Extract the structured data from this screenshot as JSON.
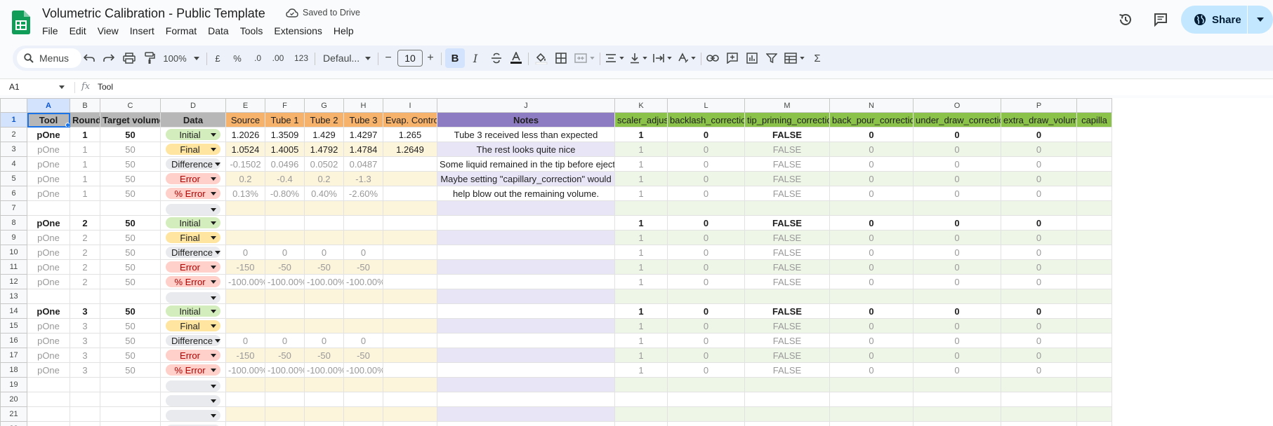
{
  "app": {
    "title": "Volumetric Calibration - Public Template",
    "saved_status": "Saved to Drive",
    "share_label": "Share"
  },
  "menubar": [
    "File",
    "Edit",
    "View",
    "Insert",
    "Format",
    "Data",
    "Tools",
    "Extensions",
    "Help"
  ],
  "toolbar": {
    "menus_label": "Menus",
    "zoom": "100%",
    "currency": "£",
    "percent": "%",
    "dec_decrease": ".0",
    "dec_increase": ".00",
    "number_format": "123",
    "font": "Defaul...",
    "font_size": "10",
    "minus": "−",
    "plus": "+",
    "bold": "B",
    "italic": "I",
    "sum": "Σ"
  },
  "formula_bar": {
    "cell_ref": "A1",
    "fx": "fx",
    "value": "Tool"
  },
  "icons": {
    "logo": "sheets-logo-icon",
    "history": "history-icon",
    "comments": "comment-icon",
    "share": "globe-icon",
    "search": "search-icon"
  },
  "colors": {
    "header_gray": "#b7b7b7",
    "header_orange": "#f6b26b",
    "header_purple": "#8e7cc3",
    "header_green": "#8bc34a",
    "chip_initial": "#d4edbc",
    "chip_final": "#ffe5a0",
    "chip_error": "#ffcfc9",
    "accent": "#1a73e8"
  },
  "grid": {
    "column_letters": [
      "A",
      "B",
      "C",
      "D",
      "E",
      "F",
      "G",
      "H",
      "I",
      "J",
      "K",
      "L",
      "M",
      "N",
      "O",
      "P",
      ""
    ],
    "header_row": [
      "Tool",
      "Round",
      "Target volume",
      "Data",
      "Source",
      "Tube 1",
      "Tube 2",
      "Tube 3",
      "Evap. Control",
      "Notes",
      "scaler_adjust",
      "backlash_correction",
      "tip_priming_correction",
      "back_pour_correction",
      "under_draw_correction",
      "extra_draw_volume",
      "capilla"
    ],
    "rows": [
      {
        "num": "2",
        "first": true,
        "cells": [
          "pOne",
          "1",
          "50",
          "Initial",
          "1.2026",
          "1.3509",
          "1.429",
          "1.4297",
          "1.265",
          "Tube 3 received less than expected",
          "1",
          "0",
          "FALSE",
          "0",
          "0",
          "0",
          ""
        ]
      },
      {
        "num": "3",
        "first": false,
        "cells": [
          "pOne",
          "1",
          "50",
          "Final",
          "1.0524",
          "1.4005",
          "1.4792",
          "1.4784",
          "1.2649",
          "The rest looks quite nice",
          "1",
          "0",
          "FALSE",
          "0",
          "0",
          "0",
          ""
        ]
      },
      {
        "num": "4",
        "first": false,
        "cells": [
          "pOne",
          "1",
          "50",
          "Difference",
          "-0.1502",
          "0.0496",
          "0.0502",
          "0.0487",
          "",
          "Some liquid remained in the tip before ejection",
          "1",
          "0",
          "FALSE",
          "0",
          "0",
          "0",
          ""
        ]
      },
      {
        "num": "5",
        "first": false,
        "cells": [
          "pOne",
          "1",
          "50",
          "Error",
          "0.2",
          "-0.4",
          "0.2",
          "-1.3",
          "",
          "Maybe setting \"capillary_correction\" would",
          "1",
          "0",
          "FALSE",
          "0",
          "0",
          "0",
          ""
        ]
      },
      {
        "num": "6",
        "first": false,
        "cells": [
          "pOne",
          "1",
          "50",
          "% Error",
          "0.13%",
          "-0.80%",
          "0.40%",
          "-2.60%",
          "",
          "help blow out the remaining volume.",
          "1",
          "0",
          "FALSE",
          "0",
          "0",
          "0",
          ""
        ]
      },
      {
        "num": "7",
        "first": false,
        "cells": [
          "",
          "",
          "",
          "",
          "",
          "",
          "",
          "",
          "",
          "",
          "",
          "",
          "",
          "",
          "",
          "",
          ""
        ]
      },
      {
        "num": "8",
        "first": true,
        "cells": [
          "pOne",
          "2",
          "50",
          "Initial",
          "",
          "",
          "",
          "",
          "",
          "",
          "1",
          "0",
          "FALSE",
          "0",
          "0",
          "0",
          ""
        ]
      },
      {
        "num": "9",
        "first": false,
        "cells": [
          "pOne",
          "2",
          "50",
          "Final",
          "",
          "",
          "",
          "",
          "",
          "",
          "1",
          "0",
          "FALSE",
          "0",
          "0",
          "0",
          ""
        ]
      },
      {
        "num": "10",
        "first": false,
        "cells": [
          "pOne",
          "2",
          "50",
          "Difference",
          "0",
          "0",
          "0",
          "0",
          "",
          "",
          "1",
          "0",
          "FALSE",
          "0",
          "0",
          "0",
          ""
        ]
      },
      {
        "num": "11",
        "first": false,
        "cells": [
          "pOne",
          "2",
          "50",
          "Error",
          "-150",
          "-50",
          "-50",
          "-50",
          "",
          "",
          "1",
          "0",
          "FALSE",
          "0",
          "0",
          "0",
          ""
        ]
      },
      {
        "num": "12",
        "first": false,
        "cells": [
          "pOne",
          "2",
          "50",
          "% Error",
          "-100.00%",
          "-100.00%",
          "-100.00%",
          "-100.00%",
          "",
          "",
          "1",
          "0",
          "FALSE",
          "0",
          "0",
          "0",
          ""
        ]
      },
      {
        "num": "13",
        "first": false,
        "cells": [
          "",
          "",
          "",
          "",
          "",
          "",
          "",
          "",
          "",
          "",
          "",
          "",
          "",
          "",
          "",
          "",
          ""
        ]
      },
      {
        "num": "14",
        "first": true,
        "cells": [
          "pOne",
          "3",
          "50",
          "Initial",
          "",
          "",
          "",
          "",
          "",
          "",
          "1",
          "0",
          "FALSE",
          "0",
          "0",
          "0",
          ""
        ]
      },
      {
        "num": "15",
        "first": false,
        "cells": [
          "pOne",
          "3",
          "50",
          "Final",
          "",
          "",
          "",
          "",
          "",
          "",
          "1",
          "0",
          "FALSE",
          "0",
          "0",
          "0",
          ""
        ]
      },
      {
        "num": "16",
        "first": false,
        "cells": [
          "pOne",
          "3",
          "50",
          "Difference",
          "0",
          "0",
          "0",
          "0",
          "",
          "",
          "1",
          "0",
          "FALSE",
          "0",
          "0",
          "0",
          ""
        ]
      },
      {
        "num": "17",
        "first": false,
        "cells": [
          "pOne",
          "3",
          "50",
          "Error",
          "-150",
          "-50",
          "-50",
          "-50",
          "",
          "",
          "1",
          "0",
          "FALSE",
          "0",
          "0",
          "0",
          ""
        ]
      },
      {
        "num": "18",
        "first": false,
        "cells": [
          "pOne",
          "3",
          "50",
          "% Error",
          "-100.00%",
          "-100.00%",
          "-100.00%",
          "-100.00%",
          "",
          "",
          "1",
          "0",
          "FALSE",
          "0",
          "0",
          "0",
          ""
        ]
      },
      {
        "num": "19",
        "first": false,
        "cells": [
          "",
          "",
          "",
          "",
          "",
          "",
          "",
          "",
          "",
          "",
          "",
          "",
          "",
          "",
          "",
          "",
          ""
        ]
      },
      {
        "num": "20",
        "first": false,
        "cells": [
          "",
          "",
          "",
          "",
          "",
          "",
          "",
          "",
          "",
          "",
          "",
          "",
          "",
          "",
          "",
          "",
          ""
        ]
      },
      {
        "num": "21",
        "first": false,
        "cells": [
          "",
          "",
          "",
          "",
          "",
          "",
          "",
          "",
          "",
          "",
          "",
          "",
          "",
          "",
          "",
          "",
          ""
        ]
      },
      {
        "num": "22",
        "first": false,
        "cells": [
          "",
          "",
          "",
          "",
          "",
          "",
          "",
          "",
          "",
          "",
          "",
          "",
          "",
          "",
          "",
          "",
          ""
        ]
      }
    ]
  }
}
